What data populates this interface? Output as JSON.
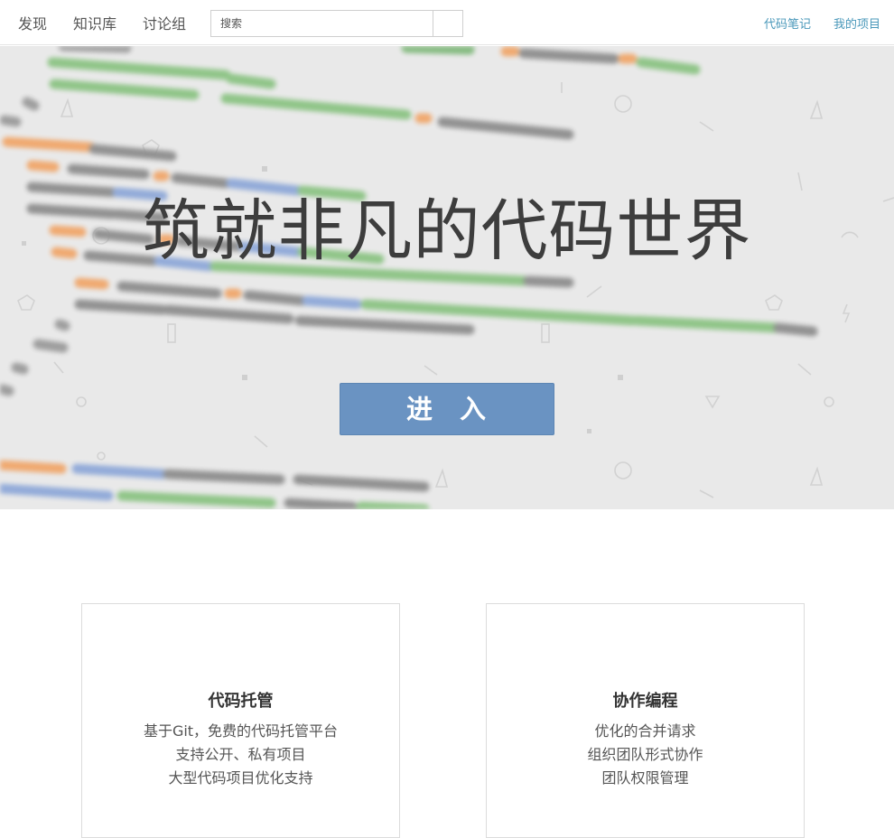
{
  "nav": {
    "links": [
      "发现",
      "知识库",
      "讨论组"
    ],
    "search": {
      "placeholder": "搜索",
      "value": ""
    },
    "right_links": [
      "代码笔记",
      "我的项目"
    ]
  },
  "hero": {
    "title": "筑就非凡的代码世界",
    "enter_label": "进 入"
  },
  "features": [
    {
      "title": "代码托管",
      "lines": [
        "基于Git，免费的代码托管平台",
        "支持公开、私有项目",
        "大型代码项目优化支持"
      ]
    },
    {
      "title": "协作编程",
      "lines": [
        "优化的合并请求",
        "组织团队形式协作",
        "团队权限管理"
      ]
    }
  ],
  "colors": {
    "accent_link": "#4a98ba",
    "button": "#6a93c2",
    "hero_bg": "#e9e9e9",
    "title": "#3d3d3d"
  }
}
